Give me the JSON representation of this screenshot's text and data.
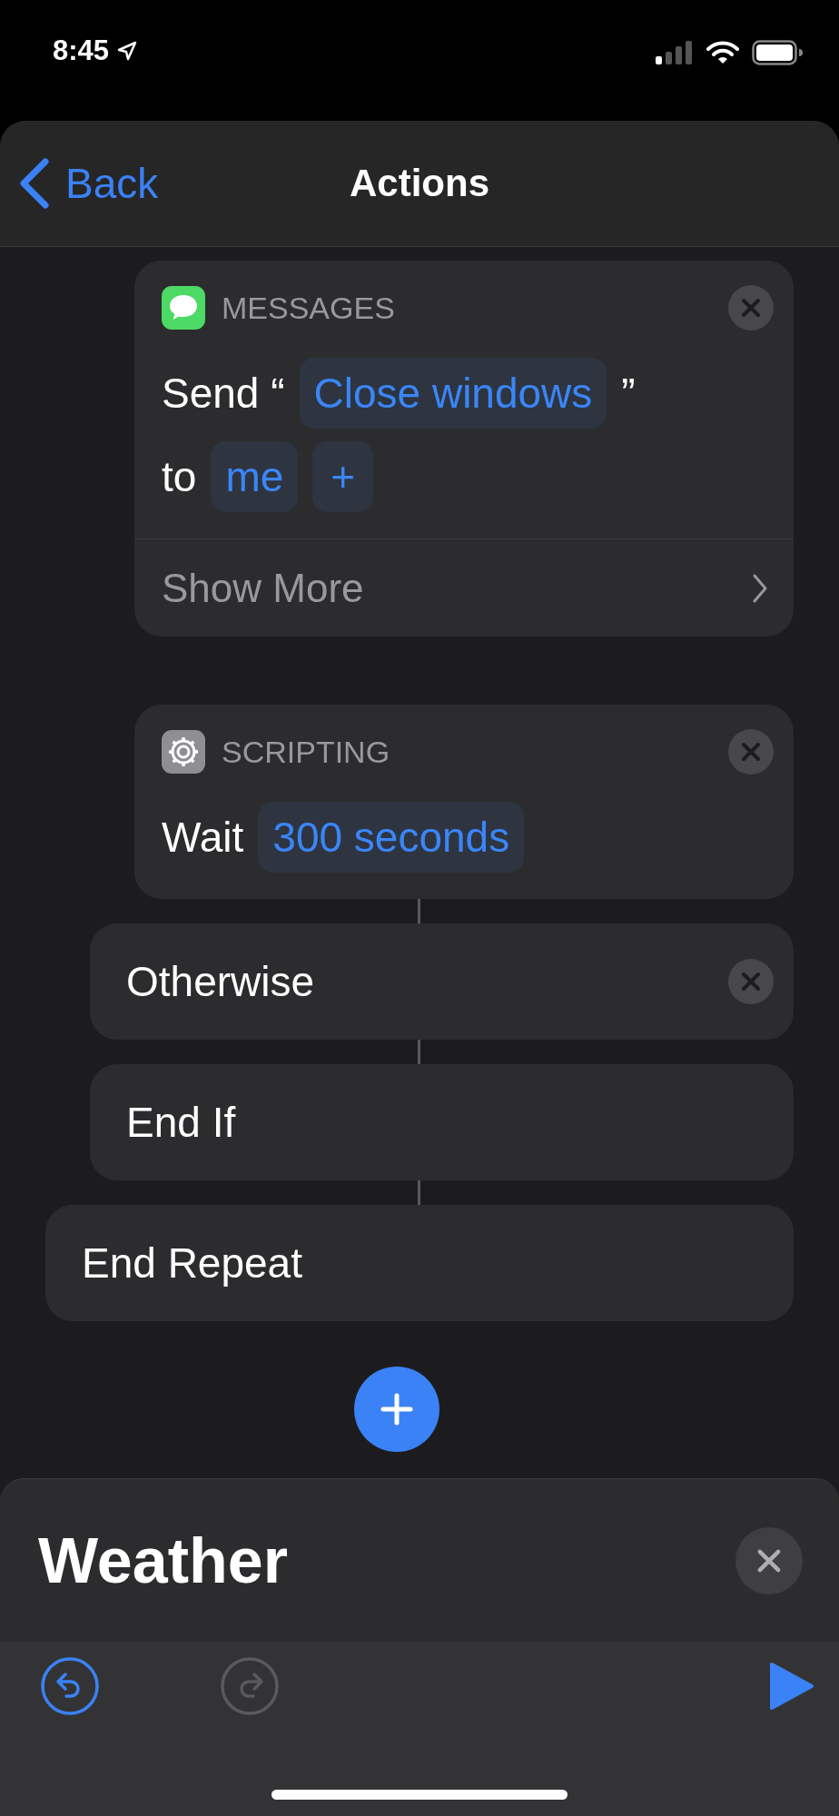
{
  "status_bar": {
    "time": "8:45"
  },
  "nav": {
    "back": "Back",
    "title": "Actions"
  },
  "blocks": [
    {
      "kind": "group",
      "children": [
        {
          "kind": "group",
          "children": [
            {
              "kind": "action",
              "app": {
                "name": "MESSAGES",
                "kind": "messages"
              },
              "removable": true,
              "lines": [
                [
                  {
                    "kind": "text",
                    "text": "Send “"
                  },
                  {
                    "kind": "token",
                    "text": "Close windows"
                  },
                  {
                    "kind": "text",
                    "text": "”"
                  }
                ],
                [
                  {
                    "kind": "text",
                    "text": "to"
                  },
                  {
                    "kind": "token",
                    "text": "me"
                  },
                  {
                    "kind": "add",
                    "text": "+"
                  }
                ]
              ],
              "show_more": "Show More"
            },
            {
              "kind": "action",
              "app": {
                "name": "SCRIPTING",
                "kind": "gear"
              },
              "connector": false,
              "removable": true,
              "lines": [
                [
                  {
                    "kind": "text",
                    "text": "Wait"
                  },
                  {
                    "kind": "token",
                    "text": "300 seconds"
                  }
                ]
              ]
            }
          ]
        },
        {
          "kind": "control",
          "label": "Otherwise",
          "connector": true,
          "removable": true
        },
        {
          "kind": "control",
          "label": "End If",
          "connector": true,
          "removable": false
        }
      ]
    },
    {
      "kind": "control",
      "label": "End Repeat",
      "connector": true,
      "removable": false
    }
  ],
  "sheet": {
    "title": "Weather"
  },
  "toolbar": {
    "undo": {
      "disabled": false
    },
    "redo": {
      "disabled": true
    }
  }
}
